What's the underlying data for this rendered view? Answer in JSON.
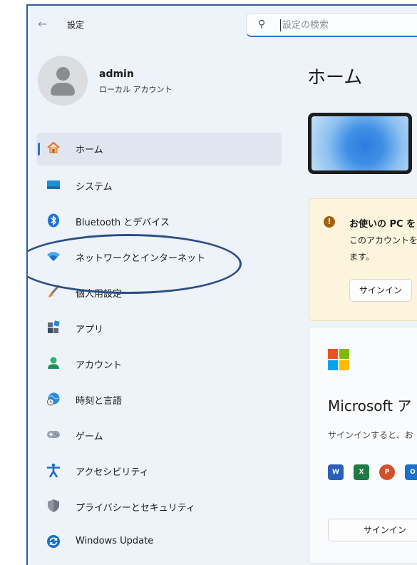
{
  "window": {
    "title": "設定",
    "back_icon": "arrow-left-icon"
  },
  "search": {
    "placeholder": "設定の検索",
    "icon": "search-icon"
  },
  "account": {
    "name": "admin",
    "type": "ローカル アカウント"
  },
  "sidebar": {
    "items": [
      {
        "label": "ホーム",
        "icon": "home-icon",
        "active": true
      },
      {
        "label": "システム",
        "icon": "monitor-icon"
      },
      {
        "label": "Bluetooth とデバイス",
        "icon": "bluetooth-icon"
      },
      {
        "label": "ネットワークとインターネット",
        "icon": "wifi-icon"
      },
      {
        "label": "個人用設定",
        "icon": "brush-icon"
      },
      {
        "label": "アプリ",
        "icon": "apps-icon"
      },
      {
        "label": "アカウント",
        "icon": "person-icon"
      },
      {
        "label": "時刻と言語",
        "icon": "globe-clock-icon"
      },
      {
        "label": "ゲーム",
        "icon": "gamepad-icon"
      },
      {
        "label": "アクセシビリティ",
        "icon": "accessibility-icon"
      },
      {
        "label": "プライバシーとセキュリティ",
        "icon": "shield-icon"
      },
      {
        "label": "Windows Update",
        "icon": "update-icon"
      }
    ]
  },
  "main": {
    "title": "ホーム",
    "notice": {
      "title": "お使いの PC を",
      "body_line1": "このアカウントを",
      "body_line2": "ます。",
      "button": "サインイン"
    },
    "microsoft_card": {
      "title": "Microsoft ア",
      "body": "サインインすると、お",
      "app_icons": [
        "word-icon",
        "excel-icon",
        "powerpoint-icon",
        "outlook-icon"
      ],
      "button": "サインイン"
    }
  },
  "colors": {
    "accent": "#2f6fcf",
    "highlight_ellipse": "#2b4f87",
    "notice_background": "#fcf4dc",
    "warning": "#a0620e"
  }
}
